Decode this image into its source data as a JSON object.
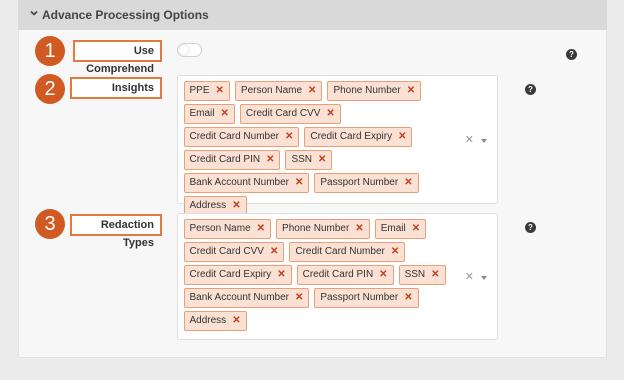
{
  "section": {
    "title": "Advance Processing Options"
  },
  "badges": [
    "1",
    "2",
    "3"
  ],
  "fields": {
    "use_comprehend": {
      "label": "Use Comprehend",
      "enabled": false
    },
    "insights": {
      "label": "Insights",
      "tags": [
        "PPE",
        "Person Name",
        "Phone Number",
        "Email",
        "Credit Card CVV",
        "Credit Card Number",
        "Credit Card Expiry",
        "Credit Card PIN",
        "SSN",
        "Bank Account Number",
        "Passport Number",
        "Address"
      ]
    },
    "redaction_types": {
      "label": "Redaction Types",
      "tags": [
        "Person Name",
        "Phone Number",
        "Email",
        "Credit Card CVV",
        "Credit Card Number",
        "Credit Card Expiry",
        "Credit Card PIN",
        "SSN",
        "Bank Account Number",
        "Passport Number",
        "Address"
      ]
    }
  },
  "icons": {
    "collapse": "chevron-down-icon",
    "help": "question-circle-icon",
    "remove": "close-icon",
    "clear": "clear-icon",
    "dropdown": "caret-down-icon"
  },
  "glyphs": {
    "help": "?",
    "remove": "✕",
    "clear": "✕"
  },
  "colors": {
    "accent": "#d05a22",
    "tag_bg": "#fbe1d3",
    "tag_border": "#e8a07a",
    "remove_x": "#c63b1b"
  }
}
